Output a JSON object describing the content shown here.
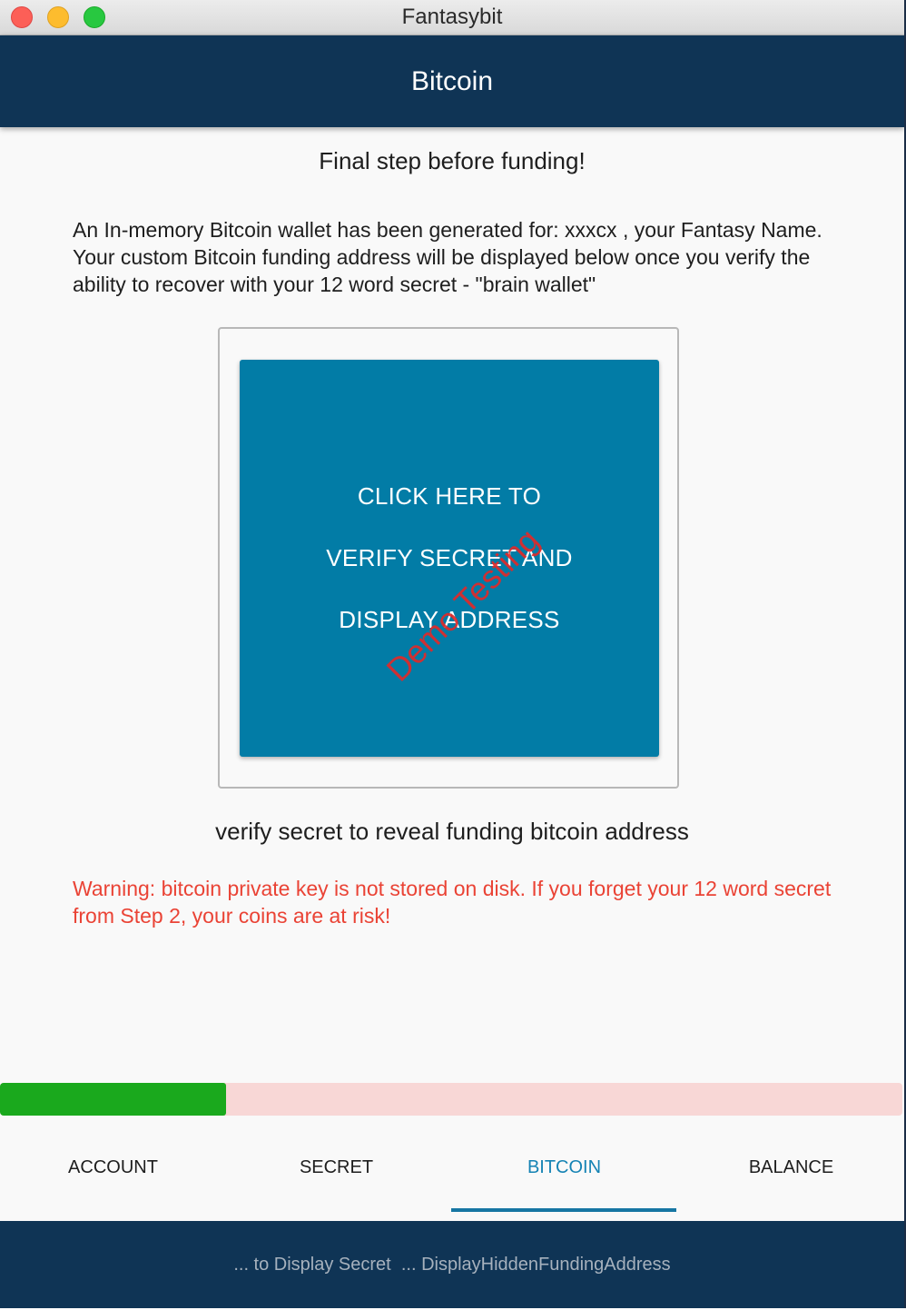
{
  "window": {
    "title": "Fantasybit"
  },
  "appbar": {
    "title": "Bitcoin"
  },
  "main": {
    "heading": "Final step before funding!",
    "intro": "An In-memory Bitcoin wallet has been generated for: xxxcx , your Fantasy Name. Your custom Bitcoin funding address will be displayed below once you verify the ability to recover with your 12 word secret - \"brain wallet\"",
    "verify_button": {
      "line1": "CLICK HERE TO",
      "line2": "VERIFY SECRET AND",
      "line3": "DISPLAY ADDRESS"
    },
    "watermark": "Demo Testing",
    "reveal_caption": "verify secret to reveal funding bitcoin address",
    "warning": "Warning: bitcoin private key is  not stored on disk. If you forget your 12 word secret from Step 2, your coins are at risk!"
  },
  "progress": {
    "fraction": 0.25,
    "fill_color": "#1aa91d",
    "track_color": "#f8d7d6"
  },
  "tabs": [
    {
      "label": "ACCOUNT",
      "active": false
    },
    {
      "label": "SECRET",
      "active": false
    },
    {
      "label": "BITCOIN",
      "active": true
    },
    {
      "label": "BALANCE",
      "active": false
    }
  ],
  "statusbar": {
    "text": "... to Display Secret  ... DisplayHiddenFundingAddress"
  },
  "colors": {
    "appbar": "#0f3455",
    "button": "#027ca6",
    "warning": "#ea4335",
    "active_tab": "#1583b4"
  }
}
